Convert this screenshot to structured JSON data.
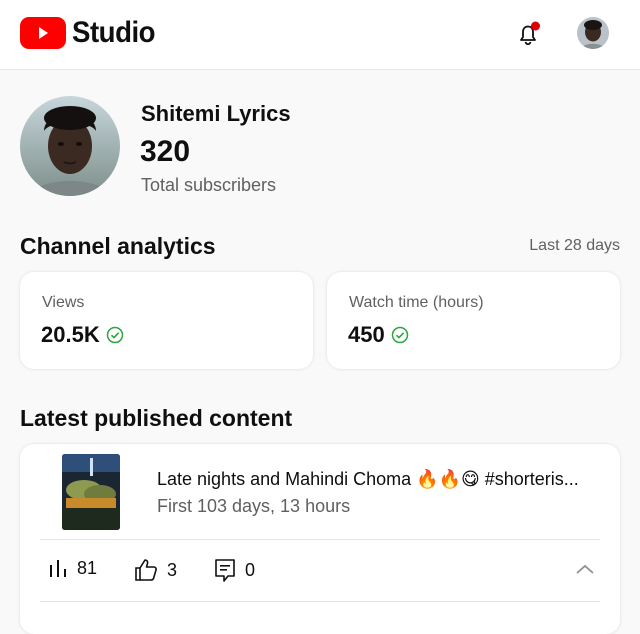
{
  "header": {
    "app_name": "Studio",
    "icons": [
      "youtube-logo-icon",
      "notifications-bell-icon",
      "account-avatar"
    ],
    "notification_dot_color": "#ff0000"
  },
  "channel": {
    "name": "Shitemi Lyrics",
    "subscriber_count": "320",
    "subscriber_label": "Total subscribers"
  },
  "analytics": {
    "title": "Channel analytics",
    "range": "Last 28 days",
    "metrics": [
      {
        "label": "Views",
        "value": "20.5K"
      },
      {
        "label": "Watch time (hours)",
        "value": "450"
      }
    ]
  },
  "latest": {
    "title": "Latest published content",
    "video": {
      "title": "Late nights and Mahindi Choma 🔥🔥😋 #shorteris...",
      "age": "First 103 days, 13 hours",
      "views": "81",
      "likes": "3",
      "comments": "0"
    }
  },
  "colors": {
    "brand_red": "#ff0000",
    "check_green": "#2ba640",
    "secondary_text": "#606060"
  }
}
